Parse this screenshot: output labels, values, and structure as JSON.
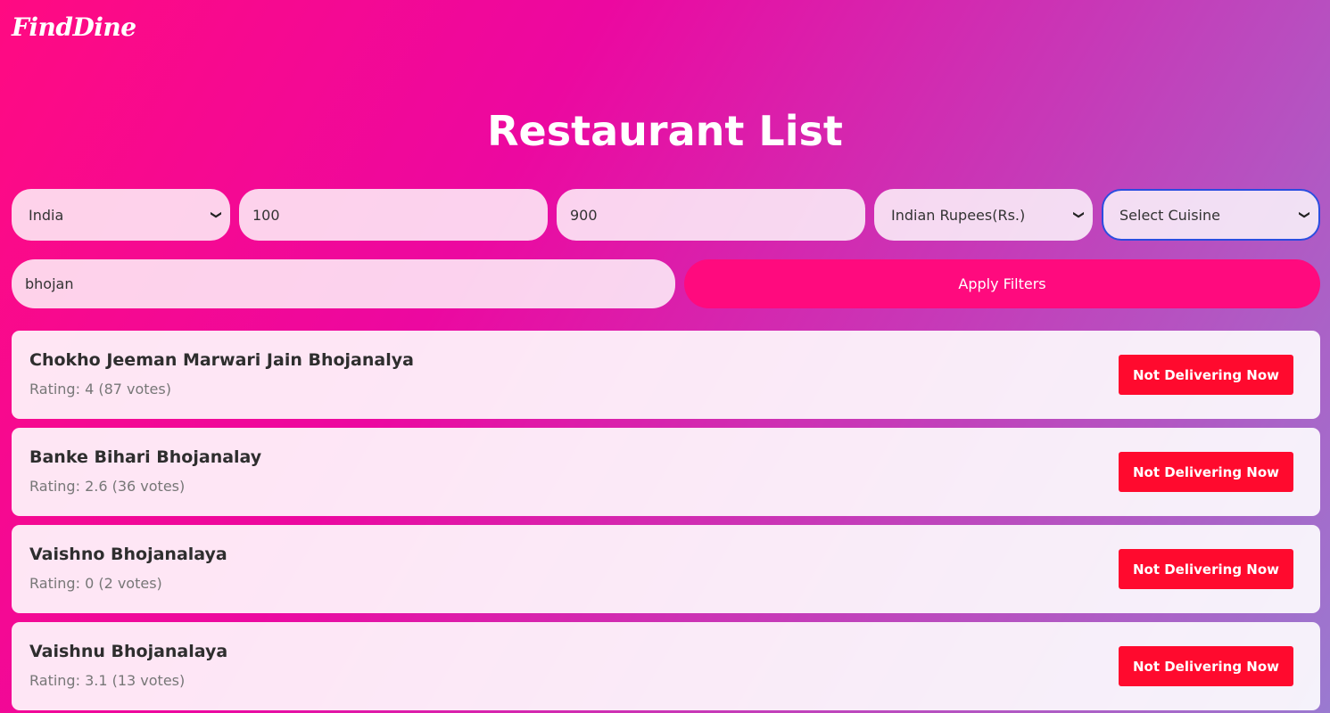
{
  "brand": {
    "logo_text": "FindDine"
  },
  "page": {
    "title": "Restaurant List"
  },
  "filters": {
    "country": "India",
    "min_cost": "100",
    "max_cost": "900",
    "currency": "Indian Rupees(Rs.)",
    "cuisine": "Select Cuisine",
    "search": "bhojan",
    "apply_label": "Apply Filters"
  },
  "restaurants": [
    {
      "name": "Chokho Jeeman Marwari Jain Bhojanalya",
      "rating": "Rating: 4 (87 votes)",
      "status": "Not Delivering Now"
    },
    {
      "name": "Banke Bihari Bhojanalay",
      "rating": "Rating: 2.6 (36 votes)",
      "status": "Not Delivering Now"
    },
    {
      "name": "Vaishno Bhojanalaya",
      "rating": "Rating: 0 (2 votes)",
      "status": "Not Delivering Now"
    },
    {
      "name": "Vaishnu Bhojanalaya",
      "rating": "Rating: 3.1 (13 votes)",
      "status": "Not Delivering Now"
    }
  ],
  "colors": {
    "accent": "#ff0a7e",
    "status_badge": "#ff0a2e",
    "focus_border": "#2b4de0"
  },
  "icons": {
    "select_arrow": "chevron-down-icon"
  }
}
